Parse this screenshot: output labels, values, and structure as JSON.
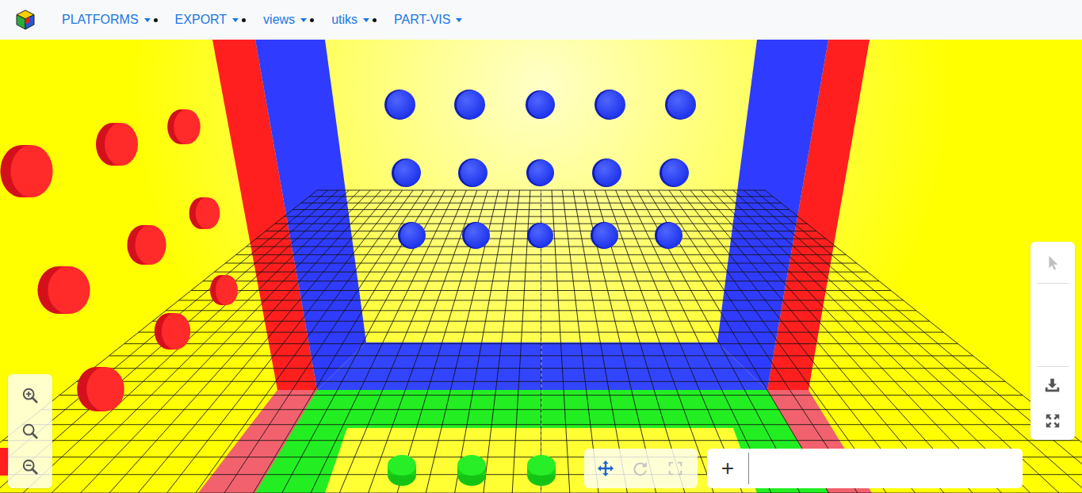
{
  "navbar": {
    "menus": [
      {
        "label": "PLATFORMS",
        "dot": true
      },
      {
        "label": "EXPORT",
        "dot": true
      },
      {
        "label": "views",
        "dot": true
      },
      {
        "label": "utiks",
        "dot": true
      },
      {
        "label": "PART-VIS",
        "dot": false
      }
    ]
  },
  "zoom_toolbar": {
    "buttons": [
      {
        "disabled": false
      },
      {
        "disabled": false
      },
      {
        "disabled": false
      }
    ]
  },
  "side_toolbar": {
    "buttons": [
      {
        "disabled": true
      },
      {
        "disabled": false
      },
      {
        "disabled": false
      }
    ]
  },
  "view_toolbar": {
    "buttons": [
      {
        "selected": true,
        "disabled": false
      },
      {
        "selected": false,
        "disabled": true
      },
      {
        "selected": false,
        "disabled": true
      }
    ]
  },
  "command": {
    "add_label": "+",
    "value": ""
  }
}
